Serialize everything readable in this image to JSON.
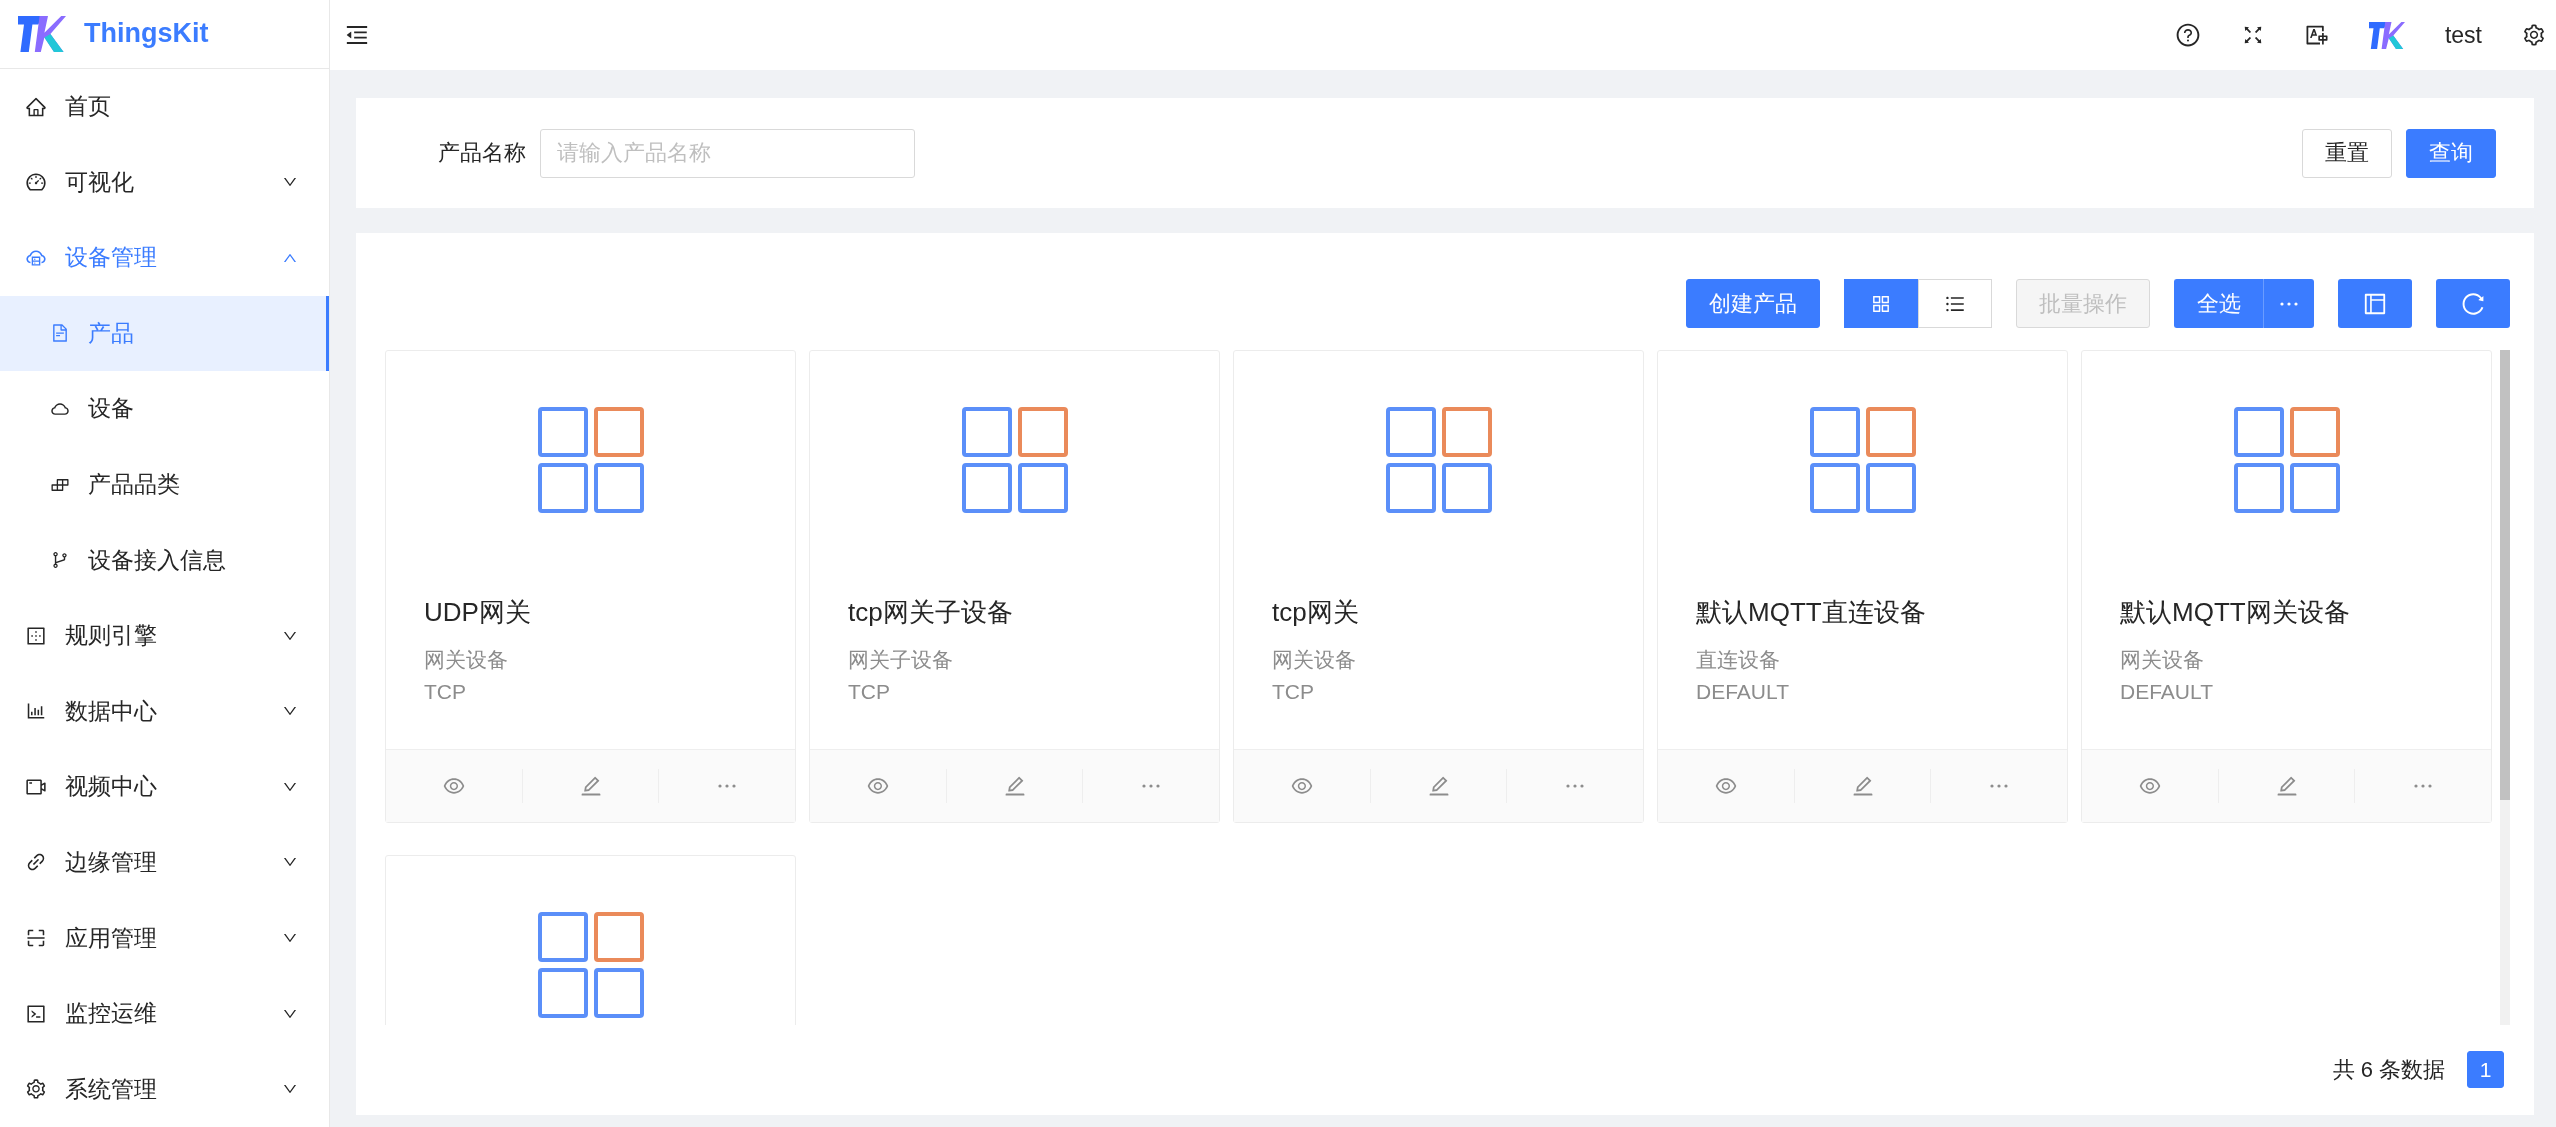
{
  "sidebar": {
    "logo_text": "ThingsKit",
    "items": [
      {
        "label": "首页",
        "selected": false
      },
      {
        "label": "可视化",
        "expanded": false,
        "selected": false
      },
      {
        "label": "设备管理",
        "expanded": true,
        "selected": false,
        "children": [
          {
            "label": "产品",
            "selected": true
          },
          {
            "label": "设备",
            "selected": false
          },
          {
            "label": "产品品类",
            "selected": false
          },
          {
            "label": "设备接入信息",
            "selected": false
          }
        ]
      },
      {
        "label": "规则引擎",
        "expanded": false,
        "selected": false
      },
      {
        "label": "数据中心",
        "expanded": false,
        "selected": false
      },
      {
        "label": "视频中心",
        "expanded": false,
        "selected": false
      },
      {
        "label": "边缘管理",
        "expanded": false,
        "selected": false
      },
      {
        "label": "应用管理",
        "expanded": false,
        "selected": false
      },
      {
        "label": "监控运维",
        "expanded": false,
        "selected": false
      },
      {
        "label": "系统管理",
        "expanded": false,
        "selected": false
      }
    ]
  },
  "header": {
    "user": "test"
  },
  "search": {
    "label": "产品名称",
    "placeholder": "请输入产品名称",
    "buttons": [
      {
        "label": "重置",
        "kind": "default"
      },
      {
        "label": "查询",
        "kind": "primary"
      }
    ]
  },
  "toolbar": {
    "create": "创建产品",
    "views": [
      {
        "kind": "grid",
        "selected": true
      },
      {
        "kind": "list",
        "selected": false
      }
    ],
    "batch": {
      "label": "批量操作",
      "disabled": true
    },
    "select_all": "全选"
  },
  "cards": [
    {
      "name": "UDP网关",
      "type": "网关设备",
      "protocol": "TCP"
    },
    {
      "name": "tcp网关子设备",
      "type": "网关子设备",
      "protocol": "TCP"
    },
    {
      "name": "tcp网关",
      "type": "网关设备",
      "protocol": "TCP"
    },
    {
      "name": "默认MQTT直连设备",
      "type": "直连设备",
      "protocol": "DEFAULT"
    },
    {
      "name": "默认MQTT网关设备",
      "type": "网关设备",
      "protocol": "DEFAULT"
    },
    {
      "kind": "clipped"
    }
  ],
  "pagination": {
    "total": "共 6 条数据",
    "pages": [
      {
        "label": "1",
        "selected": true
      }
    ]
  }
}
